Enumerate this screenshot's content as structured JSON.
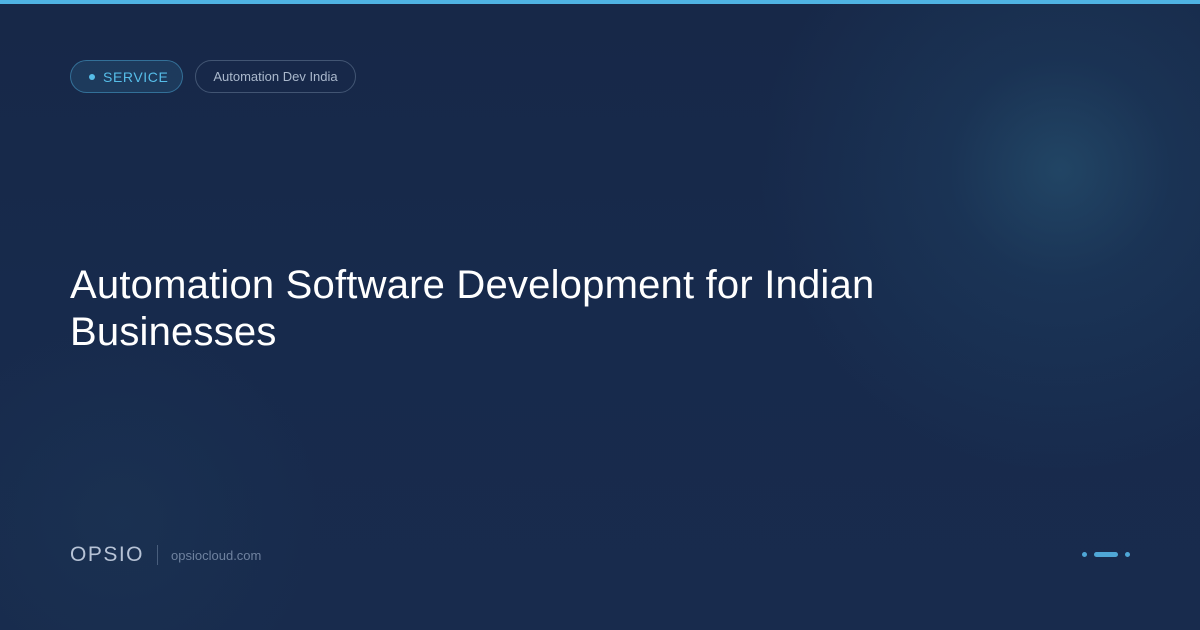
{
  "chips": {
    "service_label": "SERVICE",
    "tag_label": "Automation Dev India"
  },
  "title": "Automation Software Development for Indian Businesses",
  "footer": {
    "brand": "OPSIO",
    "url": "opsiocloud.com"
  },
  "colors": {
    "accent": "#4fb3e3",
    "background": "#16264a",
    "title": "#ffffff"
  },
  "pager": {
    "dots": 3,
    "active_index": 1
  }
}
